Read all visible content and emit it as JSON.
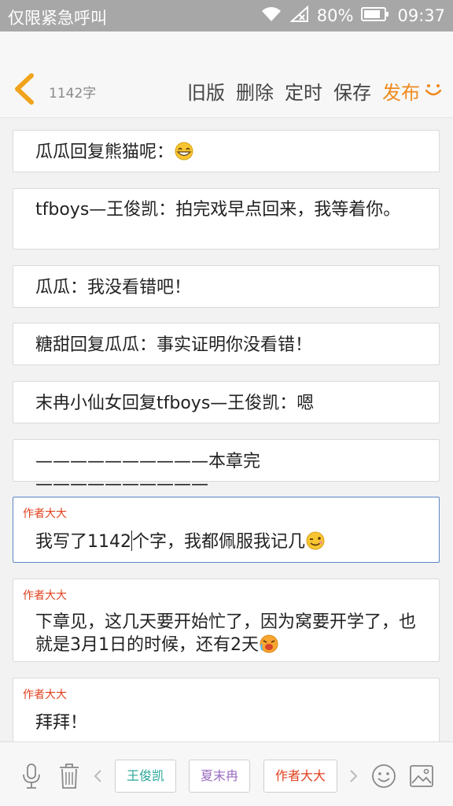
{
  "status_bar": {
    "carrier": "仅限紧急呼叫",
    "battery": "80%",
    "time": "09:37"
  },
  "header": {
    "word_count": "1142字",
    "actions": {
      "old_version": "旧版",
      "delete": "删除",
      "schedule": "定时",
      "save": "保存",
      "publish": "发布"
    }
  },
  "messages": [
    {
      "text": "瓜瓜回复熊猫呢：",
      "emoji": "grin-emoji"
    },
    {
      "text": "tfboys—王俊凯：拍完戏早点回来，我等着你。"
    },
    {
      "text": "瓜瓜：我没看错吧！"
    },
    {
      "text": "糖甜回复瓜瓜：事实证明你没看错！"
    },
    {
      "text": "末冉小仙女回复tfboys—王俊凯：嗯"
    },
    {
      "text": "——————————本章完——————————"
    }
  ],
  "author_notes": [
    {
      "author": "作者大大",
      "text_before_caret": "我写了1142",
      "text_after_caret": "个字，我都佩服我记几",
      "emoji": "wink-emoji"
    },
    {
      "author": "作者大大",
      "text": "下章见，这几天要开始忙了，因为窝要开学了，也就是3月1日的时候，还有2天",
      "emoji": "crying-emoji"
    },
    {
      "author": "作者大大",
      "text": "拜拜！"
    }
  ],
  "toolbar": {
    "characters": [
      {
        "label": "王俊凯",
        "color": "#2aa79b"
      },
      {
        "label": "夏末冉",
        "color": "#9a6cc0"
      },
      {
        "label": "作者大大",
        "color": "#e0401e"
      }
    ],
    "icons": [
      "microphone-icon",
      "trash-icon",
      "chevron-left-icon",
      "chevron-right-icon",
      "emoji-icon",
      "image-icon"
    ]
  },
  "colors": {
    "accent": "#f08a1d",
    "author": "#e0401e",
    "active_border": "#5b86c5"
  }
}
